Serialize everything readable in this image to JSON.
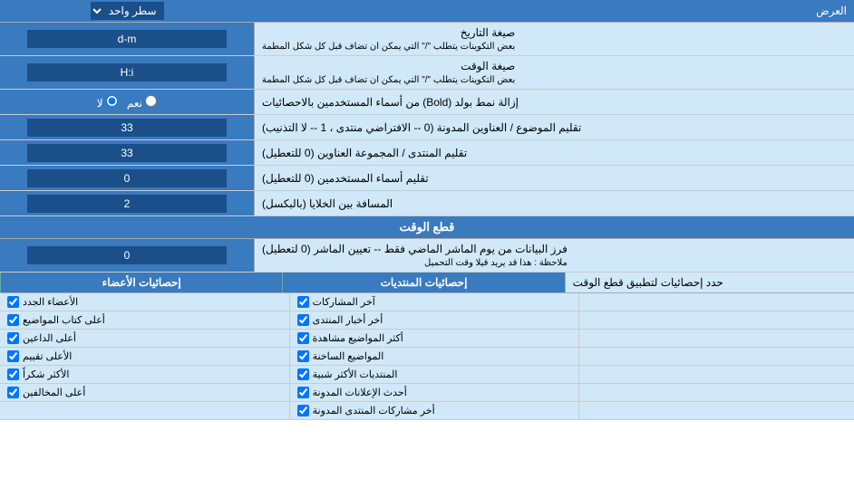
{
  "header": {
    "label": "العرض",
    "select_label": "سطر واحد"
  },
  "rows": [
    {
      "label": "صيغة التاريخ\nبعض التكوينات يتطلب \"/\" التي يمكن ان تضاف قبل كل شكل المطمة",
      "input": "d-m",
      "type": "input"
    },
    {
      "label": "صيغة الوقت\nبعض التكوينات يتطلب \"/\" التي يمكن ان تضاف قبل كل شكل المطمة",
      "input": "H:i",
      "type": "input"
    },
    {
      "label": "إزالة نمط بولد (Bold) من أسماء المستخدمين بالاحصائيات",
      "radio_yes": "نعم",
      "radio_no": "لا",
      "selected": "no",
      "type": "radio"
    },
    {
      "label": "تقليم الموضوع / العناوين المدونة (0 -- الافتراضي منتدى ، 1 -- لا التذنيب)",
      "input": "33",
      "type": "input"
    },
    {
      "label": "تقليم المنتدى / المجموعة العناوين (0 للتعطيل)",
      "input": "33",
      "type": "input"
    },
    {
      "label": "تقليم أسماء المستخدمين (0 للتعطيل)",
      "input": "0",
      "type": "input"
    },
    {
      "label": "المسافة بين الخلايا (بالبكسل)",
      "input": "2",
      "type": "input"
    }
  ],
  "section2": {
    "title": "قطع الوقت"
  },
  "row_cutoff": {
    "label": "فرز البيانات من يوم الماشر الماضي فقط -- تعيين الماشر (0 لتعطيل)\nملاحظة : هذا قد يريد قيلا وقت التحميل",
    "input": "0"
  },
  "checkboxes_section": {
    "label": "حدد إحصائيات لتطبيق قطع الوقت",
    "cols": [
      {
        "header": "إحصائيات المنتديات",
        "items": [
          "آخر المشاركات",
          "أخر أخبار المنتدى",
          "أكثر المواضيع مشاهدة",
          "المواضيع الساخنة",
          "المنتديات الأكثر شبية",
          "أحدث الإعلانات المدونة",
          "أخر مشاركات المنتدى المدونة"
        ]
      },
      {
        "header": "إحصائيات الأعضاء",
        "items": [
          "الأعضاء الجدد",
          "أعلى كتاب المواضيع",
          "أعلى الداعين",
          "الأعلى تقييم",
          "الأكثر شكراً",
          "أعلى المخالفين"
        ]
      }
    ]
  }
}
